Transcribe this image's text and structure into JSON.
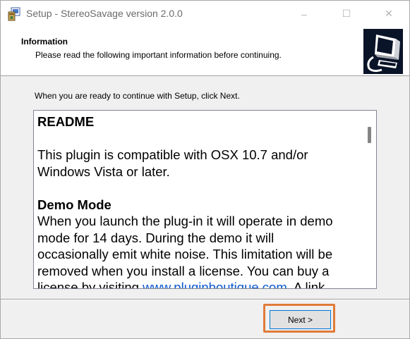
{
  "window": {
    "title": "Setup - StereoSavage version 2.0.0",
    "icons": {
      "app": "setup-installer-icon",
      "minimize": "minimize-icon",
      "maximize": "maximize-icon",
      "close": "close-icon"
    },
    "symbols": {
      "minimize": "–",
      "maximize": "☐",
      "close": "✕"
    }
  },
  "header": {
    "title": "Information",
    "subtitle": "Please read the following important information before continuing.",
    "logo_icon": "computer-setup-logo-icon"
  },
  "main": {
    "intro": "When you are ready to continue with Setup, click Next.",
    "readme": {
      "heading": "README",
      "compat_line1": "This plugin is compatible with OSX 10.7 and/or",
      "compat_line2": "Windows Vista or later.",
      "demo_heading": "Demo Mode",
      "demo_line1": "When you launch the plug-in it will operate in demo",
      "demo_line2": "mode for 14 days.  During the demo it will",
      "demo_line3": "occasionally emit white noise.  This limitation will be",
      "demo_line4": "removed when you install a license.  You can buy a",
      "demo_line5_before": "license by visiting ",
      "demo_line5_link": "www.pluginboutique.com",
      "demo_line5_after": ".  A link"
    }
  },
  "footer": {
    "next_label": "Next >"
  },
  "colors": {
    "highlight": "#e07b39",
    "link": "#0b57d0",
    "focus_border": "#0078d7"
  }
}
